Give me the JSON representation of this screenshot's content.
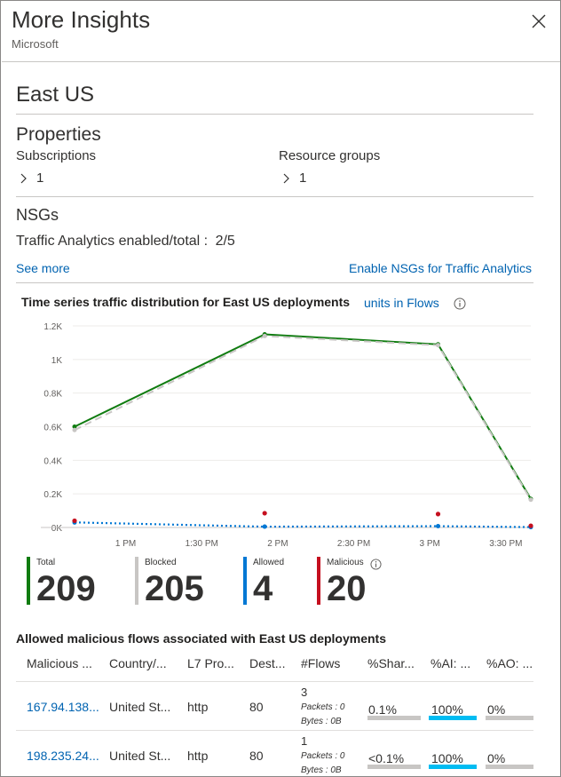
{
  "header": {
    "title": "More Insights",
    "subtitle": "Microsoft"
  },
  "region": {
    "title": "East US"
  },
  "properties": {
    "title": "Properties",
    "subscriptions_label": "Subscriptions",
    "subscriptions_count": "1",
    "resource_groups_label": "Resource groups",
    "resource_groups_count": "1"
  },
  "nsgs": {
    "title": "NSGs",
    "traffic_label": "Traffic Analytics enabled/total :",
    "traffic_value": "2/5",
    "see_more": "See more",
    "enable_link": "Enable NSGs for Traffic Analytics"
  },
  "chart": {
    "title": "Time series traffic distribution for East US deployments",
    "units_link": "units in Flows"
  },
  "chart_data": {
    "type": "line",
    "title": "Time series traffic distribution for East US deployments",
    "xlabel": "",
    "ylabel": "",
    "y_ticks": [
      "1.2K",
      "1K",
      "0.8K",
      "0.6K",
      "0.4K",
      "0.2K",
      "0K"
    ],
    "y_tick_values": [
      1200,
      1000,
      800,
      600,
      400,
      200,
      0
    ],
    "x_ticks": [
      "1 PM",
      "1:30 PM",
      "2 PM",
      "2:30 PM",
      "3 PM",
      "3:30 PM"
    ],
    "x_tick_values": [
      13.0,
      13.5,
      14.0,
      14.5,
      15.0,
      15.5
    ],
    "xlim": [
      12.67,
      15.67
    ],
    "ylim": [
      0,
      1200
    ],
    "grid": true,
    "series": [
      {
        "color": "#107c10",
        "style": "solid",
        "x": [
          12.67,
          13.92,
          15.06,
          15.67
        ],
        "y": [
          600,
          1150,
          1090,
          170
        ]
      },
      {
        "color": "#c8c6c4",
        "style": "dashed",
        "x": [
          12.67,
          13.92,
          15.06,
          15.67
        ],
        "y": [
          580,
          1140,
          1085,
          165
        ]
      },
      {
        "color": "#0078d4",
        "style": "dotted",
        "x": [
          12.67,
          13.92,
          15.06,
          15.67
        ],
        "y": [
          30,
          5,
          8,
          2
        ]
      },
      {
        "color": "#c50f1f",
        "style": "points",
        "x": [
          12.67,
          13.92,
          15.06,
          15.67
        ],
        "y": [
          40,
          85,
          80,
          10
        ]
      }
    ]
  },
  "kpis": [
    {
      "label": "Total",
      "value": "209",
      "color": "#107c10"
    },
    {
      "label": "Blocked",
      "value": "205",
      "color": "#c8c6c4"
    },
    {
      "label": "Allowed",
      "value": "4",
      "color": "#0078d4"
    },
    {
      "label": "Malicious",
      "value": "20",
      "color": "#c50f1f"
    }
  ],
  "table": {
    "title": "Allowed malicious flows associated with East US deployments",
    "columns": [
      "Malicious ...",
      "Country/...",
      "L7 Pro...",
      "Dest...",
      "#Flows",
      "%Shar...",
      "%AI: ...",
      "%AO: ..."
    ],
    "rows": [
      {
        "ip": "167.94.138...",
        "country": "United St...",
        "l7": "http",
        "dest": "80",
        "flows": "3",
        "packets": "Packets : 0",
        "bytes": "Bytes : 0B",
        "share": "0.1%",
        "ai": "100%",
        "ao": "0%"
      },
      {
        "ip": "198.235.24...",
        "country": "United St...",
        "l7": "http",
        "dest": "80",
        "flows": "1",
        "packets": "Packets : 0",
        "bytes": "Bytes : 0B",
        "share": "<0.1%",
        "ai": "100%",
        "ao": "0%"
      }
    ]
  }
}
